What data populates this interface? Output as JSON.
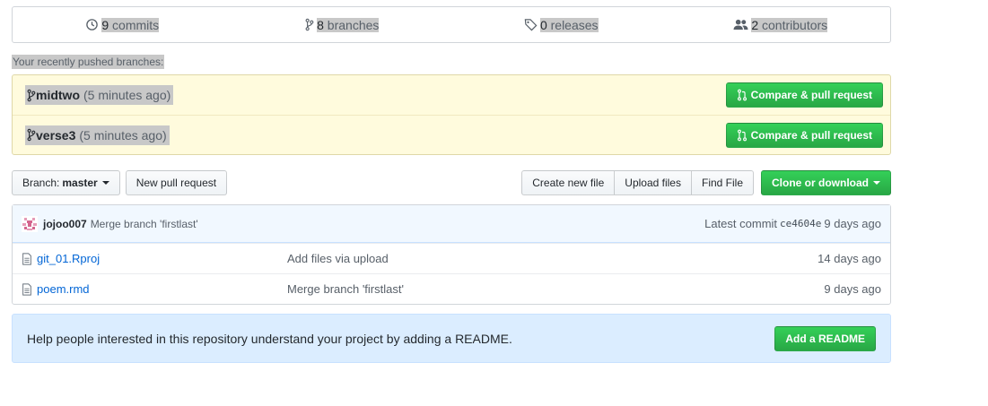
{
  "summary": {
    "commits": {
      "icon": "history-icon",
      "count": "9",
      "label": "commits"
    },
    "branches": {
      "icon": "branch-icon",
      "count": "8",
      "label": "branches"
    },
    "releases": {
      "icon": "tag-icon",
      "count": "0",
      "label": "releases"
    },
    "contributors": {
      "icon": "people-icon",
      "count": "2",
      "label": "contributors"
    }
  },
  "recent": {
    "title": "Your recently pushed branches:",
    "items": [
      {
        "branch": "midtwo",
        "ago": "(5 minutes ago)",
        "button": "Compare & pull request"
      },
      {
        "branch": "verse3",
        "ago": "(5 minutes ago)",
        "button": "Compare & pull request"
      }
    ]
  },
  "toolbar": {
    "branch_prefix": "Branch:",
    "branch_value": "master",
    "new_pr": "New pull request",
    "create_file": "Create new file",
    "upload_files": "Upload files",
    "find_file": "Find File",
    "clone": "Clone or download"
  },
  "commit": {
    "author": "jojoo007",
    "message": "Merge branch 'firstlast'",
    "latest_label": "Latest commit",
    "sha": "ce4604e",
    "age": "9 days ago"
  },
  "files": [
    {
      "name": "git_01.Rproj",
      "message": "Add files via upload",
      "age": "14 days ago"
    },
    {
      "name": "poem.rmd",
      "message": "Merge branch 'firstlast'",
      "age": "9 days ago"
    }
  ],
  "readme": {
    "text": "Help people interested in this repository understand your project by adding a README.",
    "button": "Add a README"
  },
  "colors": {
    "accent_green": "#28a745",
    "link_blue": "#0366d6",
    "recent_bg": "#fffbdd",
    "readme_bg": "#dbedff"
  }
}
